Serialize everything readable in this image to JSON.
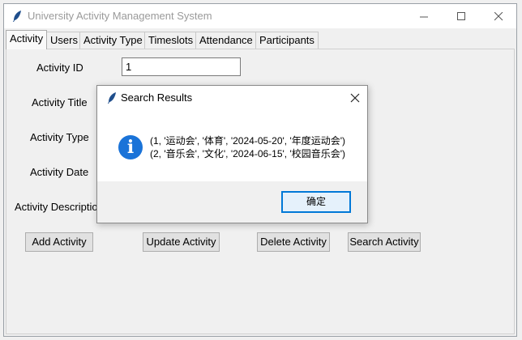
{
  "window": {
    "title": "University Activity Management System"
  },
  "tabs": [
    {
      "label": "Activity",
      "active": true
    },
    {
      "label": "Users",
      "active": false
    },
    {
      "label": "Activity Type",
      "active": false
    },
    {
      "label": "Timeslots",
      "active": false
    },
    {
      "label": "Attendance",
      "active": false
    },
    {
      "label": "Participants",
      "active": false
    }
  ],
  "form": {
    "activity_id_label": "Activity ID",
    "activity_id_value": "1",
    "activity_title_label": "Activity Title",
    "activity_type_label": "Activity Type",
    "activity_date_label": "Activity Date",
    "activity_description_label": "Activity Description"
  },
  "buttons": {
    "add": "Add Activity",
    "update": "Update Activity",
    "delete": "Delete Activity",
    "search": "Search Activity"
  },
  "dialog": {
    "title": "Search Results",
    "icon": "info-icon",
    "lines": [
      "(1, '运动会', '体育', '2024-05-20', '年度运动会')",
      "(2, '音乐会', '文化', '2024-06-15', '校园音乐会')"
    ],
    "ok_label": "确定"
  },
  "colors": {
    "accent": "#0078d7",
    "info_icon": "#1a73d8"
  }
}
